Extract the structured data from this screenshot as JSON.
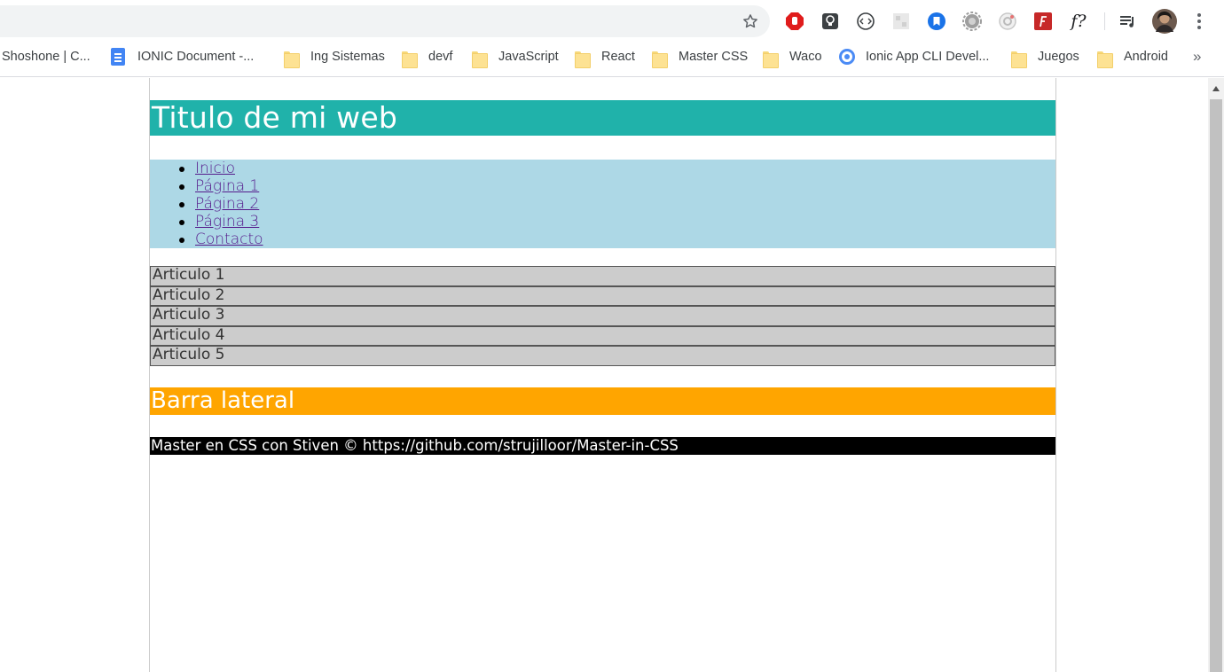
{
  "browser": {
    "bookmarks": [
      {
        "label": "Shoshone | C...",
        "icon": "none"
      },
      {
        "label": "IONIC Document -...",
        "icon": "google-docs-icon"
      },
      {
        "label": "Ing Sistemas",
        "icon": "folder-icon"
      },
      {
        "label": "devf",
        "icon": "folder-icon"
      },
      {
        "label": "JavaScript",
        "icon": "folder-icon"
      },
      {
        "label": "React",
        "icon": "folder-icon"
      },
      {
        "label": "Master CSS",
        "icon": "folder-icon"
      },
      {
        "label": "Waco",
        "icon": "folder-icon"
      },
      {
        "label": "Ionic App CLI Devel...",
        "icon": "ionic-icon"
      },
      {
        "label": "Juegos",
        "icon": "folder-icon"
      },
      {
        "label": "Android",
        "icon": "folder-icon"
      }
    ],
    "overflow_label": "»",
    "extensions": [
      "adblock-icon",
      "lightbulb-icon",
      "code-icon",
      "grid-extension-icon",
      "bookmark-extension-icon",
      "gear-extension-icon",
      "camera-extension-icon",
      "font-extension-icon",
      "whatfont-icon",
      "playlist-icon",
      "profile-avatar",
      "menu-dots-icon"
    ],
    "whatfont_label": "f?"
  },
  "page": {
    "header_title": "Titulo de mi web",
    "nav": [
      {
        "label": "Inicio"
      },
      {
        "label": "Página 1"
      },
      {
        "label": "Página 2"
      },
      {
        "label": "Página 3"
      },
      {
        "label": "Contacto"
      }
    ],
    "articles": [
      {
        "label": "Articulo 1"
      },
      {
        "label": "Articulo 2"
      },
      {
        "label": "Articulo 3"
      },
      {
        "label": "Articulo 4"
      },
      {
        "label": "Articulo 5"
      }
    ],
    "sidebar_title": "Barra lateral",
    "footer": "Master en CSS con Stiven © https://github.com/strujilloor/Master-in-CSS"
  },
  "colors": {
    "header": "#20b2aa",
    "nav": "#add8e6",
    "article": "#cccccc",
    "sidebar": "#ffa500",
    "footer": "#000000",
    "link": "#551a8b"
  }
}
